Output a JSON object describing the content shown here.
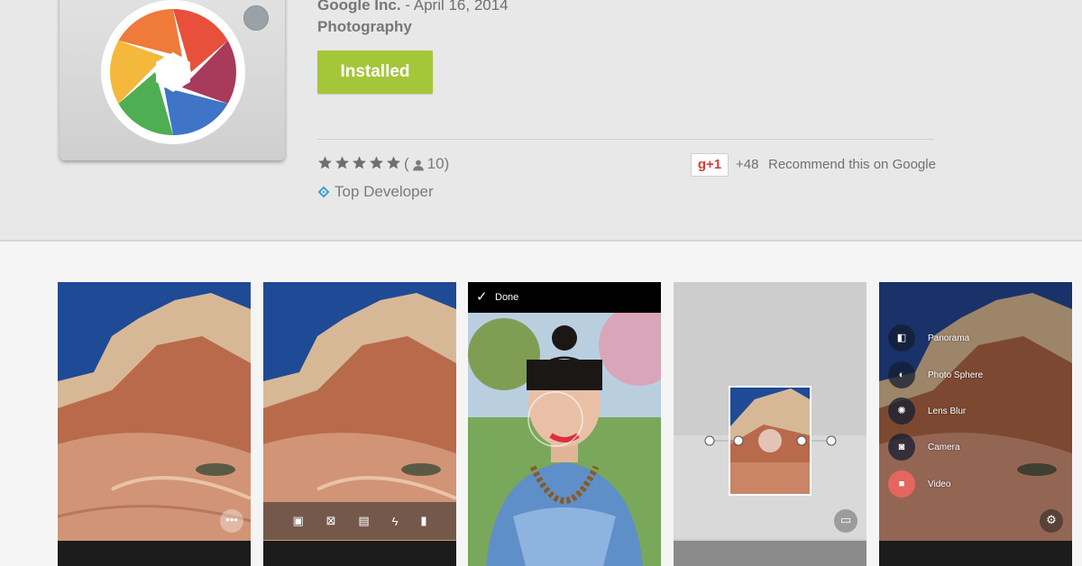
{
  "app": {
    "developer": "Google Inc.",
    "date_separator": " - ",
    "date": "April 16, 2014",
    "category": "Photography",
    "install_label": "Installed",
    "rating_stars": 5,
    "rating_count_open": "(",
    "rating_count": "10)",
    "badge": "Top Developer",
    "gplus_label": "g+1",
    "gplus_count": "+48",
    "recommend_text": "Recommend this on Google"
  },
  "screenshots": {
    "done_label": "Done",
    "modes": [
      "Panorama",
      "Photo Sphere",
      "Lens Blur",
      "Camera",
      "Video"
    ]
  },
  "colors": {
    "install_green": "#a4c639",
    "gplus_red": "#d73d32",
    "video_accent": "#e5665e"
  },
  "icons": [
    "camera-aperture-icon",
    "star-icon",
    "person-icon",
    "diamond-badge-icon",
    "overflow-menu-icon",
    "check-icon",
    "settings-gear-icon"
  ]
}
